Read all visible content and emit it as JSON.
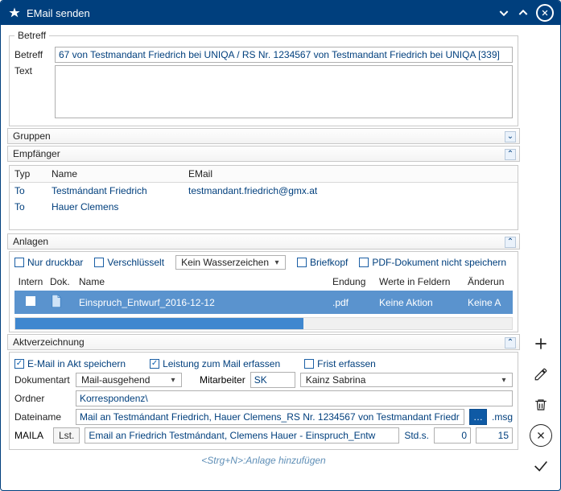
{
  "window": {
    "title": "EMail senden"
  },
  "betreff": {
    "legend": "Betreff",
    "subject_label": "Betreff",
    "subject_value": "67 von Testmandant Friedrich bei UNIQA / RS Nr. 1234567 von Testmandant Friedrich bei UNIQA [339]",
    "text_label": "Text",
    "text_value": ""
  },
  "gruppen": {
    "header": "Gruppen"
  },
  "empfaenger": {
    "header": "Empfänger",
    "cols": {
      "typ": "Typ",
      "name": "Name",
      "email": "EMail"
    },
    "rows": [
      {
        "typ": "To",
        "name": "Testmándant Friedrich",
        "email": "testmandant.friedrich@gmx.at"
      },
      {
        "typ": "To",
        "name": "Hauer Clemens",
        "email": ""
      }
    ]
  },
  "anlagen": {
    "header": "Anlagen",
    "opts": {
      "druckbar": "Nur druckbar",
      "verschluesselt": "Verschlüsselt",
      "wasserzeichen": "Kein Wasserzeichen",
      "briefkopf": "Briefkopf",
      "pdf_nicht_speichern": "PDF-Dokument nicht speichern"
    },
    "cols": {
      "intern": "Intern",
      "dok": "Dok.",
      "name": "Name",
      "endung": "Endung",
      "werte": "Werte in Feldern",
      "aender": "Änderun"
    },
    "rows": [
      {
        "intern": false,
        "name": "Einspruch_Entwurf_2016-12-12",
        "endung": ".pdf",
        "werte": "Keine Aktion",
        "aender": "Keine A"
      }
    ]
  },
  "aktv": {
    "header": "Aktverzeichnung",
    "chk_speichern": "E-Mail in Akt speichern",
    "chk_leistung": "Leistung zum Mail erfassen",
    "chk_frist": "Frist erfassen",
    "dokumentart_label": "Dokumentart",
    "dokumentart_value": "Mail-ausgehend",
    "mitarbeiter_label": "Mitarbeiter",
    "mitarbeiter_value": "SK",
    "mitarbeiter_name": "Kainz Sabrina",
    "ordner_label": "Ordner",
    "ordner_value": "Korrespondenz\\",
    "datei_label": "Dateiname",
    "datei_value": "Mail an Testmándant Friedrich, Hauer Clemens_RS Nr. 1234567 von Testmandant Friedr",
    "datei_ext": ".msg",
    "maila_label": "MAILA",
    "lst_btn": "Lst.",
    "maila_value": "Email an Friedrich Testmándant, Clemens Hauer - Einspruch_Entw",
    "stds_label": "Std.s.",
    "stds_val": "0",
    "min_val": "15"
  },
  "footer_hint": "<Strg+N>:Anlage hinzufügen"
}
